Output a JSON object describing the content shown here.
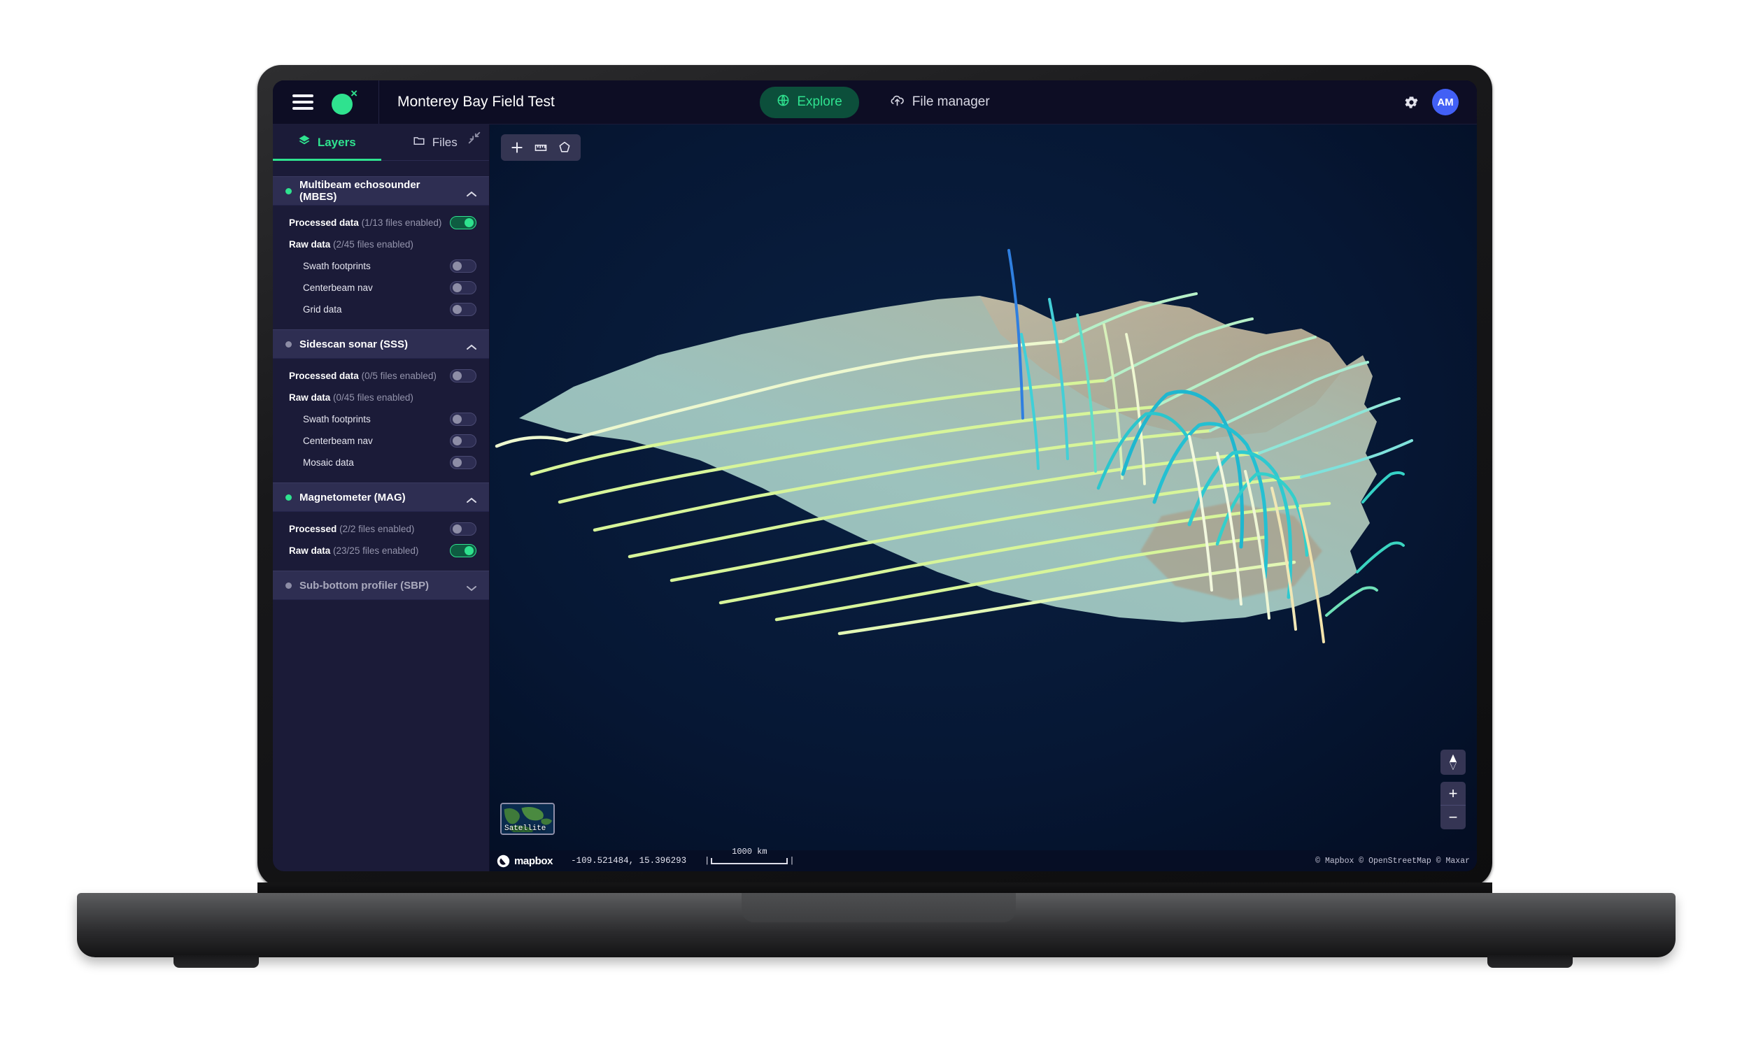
{
  "header": {
    "menu_icon": "hamburger-menu-icon",
    "logo_icon": "brand-logo-icon",
    "project_title": "Monterey Bay Field Test",
    "explore_label": "Explore",
    "explore_icon": "globe-icon",
    "file_manager_label": "File manager",
    "file_manager_icon": "upload-cloud-icon",
    "settings_icon": "gear-icon",
    "avatar_initials": "AM",
    "accent_color": "#2fe28f",
    "avatar_color": "#4260f5"
  },
  "sidebar": {
    "tabs": [
      {
        "label": "Layers",
        "icon": "layers-icon",
        "active": true
      },
      {
        "label": "Files",
        "icon": "folder-icon",
        "active": false
      }
    ],
    "collapse_icon": "collapse-panel-icon",
    "groups": [
      {
        "title": "Multibeam echosounder (MBES)",
        "status": "active",
        "status_color": "#2fe28f",
        "expanded": true,
        "chevron": "chevron-up-icon",
        "rows": [
          {
            "label": "Processed data",
            "count": "(1/13 files enabled)",
            "toggle": "on",
            "indent": false
          },
          {
            "label": "Raw data",
            "count": "(2/45 files enabled)",
            "toggle": "none",
            "indent": false
          },
          {
            "label": "Swath footprints",
            "count": "",
            "toggle": "off",
            "indent": true
          },
          {
            "label": "Centerbeam nav",
            "count": "",
            "toggle": "off",
            "indent": true
          },
          {
            "label": "Grid data",
            "count": "",
            "toggle": "off",
            "indent": true
          }
        ]
      },
      {
        "title": "Sidescan sonar (SSS)",
        "status": "inactive",
        "status_color": "#8d8da6",
        "expanded": true,
        "chevron": "chevron-up-icon",
        "rows": [
          {
            "label": "Processed data",
            "count": "(0/5 files enabled)",
            "toggle": "off",
            "indent": false
          },
          {
            "label": "Raw data",
            "count": "(0/45 files enabled)",
            "toggle": "none",
            "indent": false
          },
          {
            "label": "Swath footprints",
            "count": "",
            "toggle": "off",
            "indent": true
          },
          {
            "label": "Centerbeam nav",
            "count": "",
            "toggle": "off",
            "indent": true
          },
          {
            "label": "Mosaic data",
            "count": "",
            "toggle": "off",
            "indent": true
          }
        ]
      },
      {
        "title": "Magnetometer (MAG)",
        "status": "active",
        "status_color": "#2fe28f",
        "expanded": true,
        "chevron": "chevron-up-icon",
        "rows": [
          {
            "label": "Processed",
            "count": "(2/2 files enabled)",
            "toggle": "off",
            "indent": false
          },
          {
            "label": "Raw data",
            "count": "(23/25 files enabled)",
            "toggle": "on",
            "indent": false
          }
        ]
      },
      {
        "title": "Sub-bottom profiler (SBP)",
        "status": "inactive",
        "status_color": "#8d8da6",
        "expanded": false,
        "chevron": "chevron-down-icon",
        "rows": []
      }
    ]
  },
  "map": {
    "toolbar": [
      {
        "name": "add-point-icon",
        "glyph": "+"
      },
      {
        "name": "measure-ruler-icon",
        "glyph": "ruler"
      },
      {
        "name": "draw-polygon-icon",
        "glyph": "polygon"
      }
    ],
    "basemap_label": "Satellite",
    "mapbox_wordmark": "mapbox",
    "coordinates": "-109.521484, 15.396293",
    "scalebar_text": "1000 km",
    "attribution": "© Mapbox © OpenStreetMap © Maxar",
    "compass_icon": "compass-needle-icon",
    "zoom_in_label": "+",
    "zoom_out_label": "−",
    "ocean_color": "#05132c",
    "bathymetry_color": "#a8cfc8",
    "track_color_primary": "#d7f59a",
    "track_color_secondary": "#29c4c9"
  }
}
